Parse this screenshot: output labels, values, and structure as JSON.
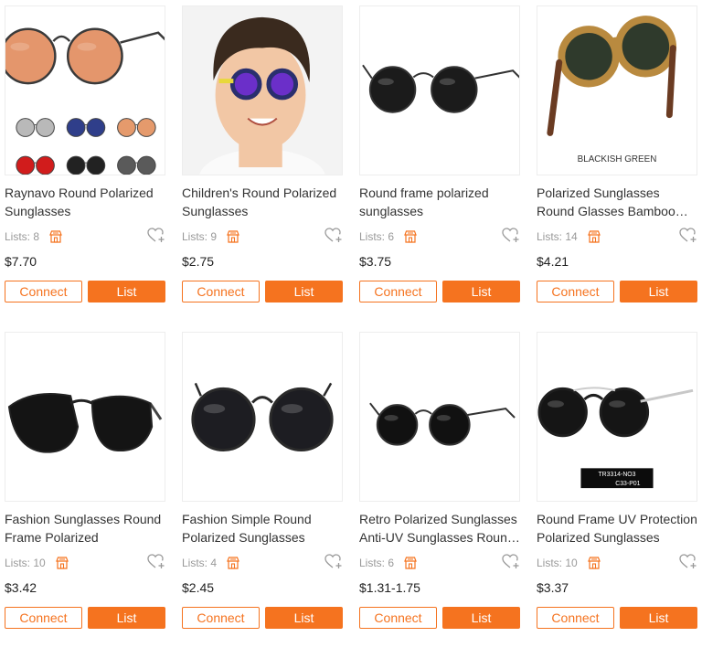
{
  "colors": {
    "accent": "#f5731f",
    "muted": "#999999",
    "text": "#333333"
  },
  "products": [
    {
      "title": "Raynavo Round Polarized Sunglasses",
      "lists": "Lists: 8",
      "price": "$7.70",
      "connect": "Connect",
      "list": "List",
      "image": "round-orange-lens-sunglasses",
      "image_text": ""
    },
    {
      "title": "Children's Round Polarized Sunglasses",
      "lists": "Lists: 9",
      "price": "$2.75",
      "connect": "Connect",
      "list": "List",
      "image": "child-wearing-sunglasses",
      "image_text": ""
    },
    {
      "title": "Round frame polarized sunglasses",
      "lists": "Lists: 6",
      "price": "$3.75",
      "connect": "Connect",
      "list": "List",
      "image": "round-black-sunglasses",
      "image_text": ""
    },
    {
      "title": "Polarized Sunglasses Round Glasses Bamboo Wood Sunglasses",
      "lists": "Lists: 14",
      "price": "$4.21",
      "connect": "Connect",
      "list": "List",
      "image": "bamboo-tortoise-sunglasses",
      "image_text": "BLACKISH GREEN"
    },
    {
      "title": "Fashion Sunglasses Round Frame Polarized",
      "lists": "Lists: 10",
      "price": "$3.42",
      "connect": "Connect",
      "list": "List",
      "image": "black-cat-eye-sunglasses",
      "image_text": ""
    },
    {
      "title": "Fashion Simple Round Polarized Sunglasses",
      "lists": "Lists: 4",
      "price": "$2.45",
      "connect": "Connect",
      "list": "List",
      "image": "round-metal-sunglasses",
      "image_text": ""
    },
    {
      "title": "Retro Polarized Sunglasses Anti-UV Sunglasses Round Frame",
      "lists": "Lists: 6",
      "price": "$1.31-1.75",
      "connect": "Connect",
      "list": "List",
      "image": "retro-round-sunglasses",
      "image_text": ""
    },
    {
      "title": "Round Frame UV Protection Polarized Sunglasses",
      "lists": "Lists: 10",
      "price": "$3.37",
      "connect": "Connect",
      "list": "List",
      "image": "double-bridge-sunglasses",
      "image_text": "TR3314-NO3\nC33-P01"
    }
  ]
}
